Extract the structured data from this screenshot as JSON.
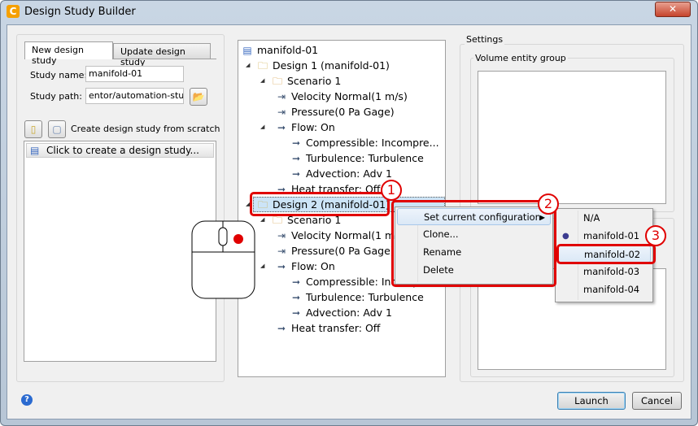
{
  "window": {
    "title": "Design Study Builder",
    "app_icon": "C",
    "close": "✕"
  },
  "left": {
    "tabs": [
      {
        "label": "New design study",
        "active": true
      },
      {
        "label": "Update design study",
        "active": false
      }
    ],
    "study_name_label": "Study name:",
    "study_name_value": "manifold-01",
    "study_path_label": "Study path:",
    "study_path_value": "entor/automation-study",
    "create_label": "Create design study from scratch",
    "list_item": "Click to create a design study..."
  },
  "tree": [
    {
      "label": "manifold-01",
      "level": 0,
      "icon": "table-icon"
    },
    {
      "label": "Design 1 (manifold-01)",
      "level": 1,
      "icon": "design-folder-icon"
    },
    {
      "label": "Scenario 1",
      "level": 2,
      "icon": "scenario-folder-icon"
    },
    {
      "label": "Velocity Normal(1 m/s)",
      "level": 3,
      "icon": "boundary-condition-icon"
    },
    {
      "label": "Pressure(0 Pa Gage)",
      "level": 3,
      "icon": "boundary-condition-icon"
    },
    {
      "label": "Flow: On",
      "level": 3,
      "icon": "arrow-right-icon"
    },
    {
      "label": "Compressible: Incompre...",
      "level": 4,
      "icon": "arrow-right-icon"
    },
    {
      "label": "Turbulence: Turbulence",
      "level": 4,
      "icon": "arrow-right-icon"
    },
    {
      "label": "Advection: Adv 1",
      "level": 4,
      "icon": "arrow-right-icon"
    },
    {
      "label": "Heat transfer: Off",
      "level": 3,
      "icon": "arrow-right-icon"
    },
    {
      "label": "Design 2 (manifold-01)",
      "level": 1,
      "icon": "design-folder-icon",
      "selected": true
    },
    {
      "label": "Scenario 1",
      "level": 2,
      "icon": "scenario-folder-icon"
    },
    {
      "label": "Velocity Normal(1 m/s)",
      "level": 3,
      "icon": "boundary-condition-icon"
    },
    {
      "label": "Pressure(0 Pa Gage)",
      "level": 3,
      "icon": "boundary-condition-icon"
    },
    {
      "label": "Flow: On",
      "level": 3,
      "icon": "arrow-right-icon"
    },
    {
      "label": "Compressible: Incompre...",
      "level": 4,
      "icon": "arrow-right-icon"
    },
    {
      "label": "Turbulence: Turbulence",
      "level": 4,
      "icon": "arrow-right-icon"
    },
    {
      "label": "Advection: Adv 1",
      "level": 4,
      "icon": "arrow-right-icon"
    },
    {
      "label": "Heat transfer: Off",
      "level": 3,
      "icon": "arrow-right-icon"
    }
  ],
  "settings": {
    "title": "Settings",
    "volume_group": "Volume entity group"
  },
  "context_menu": [
    "Set current configuration",
    "Clone...",
    "Rename",
    "Delete"
  ],
  "submenu": {
    "items": [
      "N/A",
      "manifold-01",
      "manifold-02",
      "manifold-03",
      "manifold-04"
    ],
    "checked": "manifold-01",
    "highlighted": "manifold-02"
  },
  "callouts": [
    "1",
    "2",
    "3"
  ],
  "buttons": {
    "launch": "Launch",
    "cancel": "Cancel",
    "help": "?"
  },
  "colors": {
    "callout": "#e00000",
    "selection": "#cce4f7"
  }
}
